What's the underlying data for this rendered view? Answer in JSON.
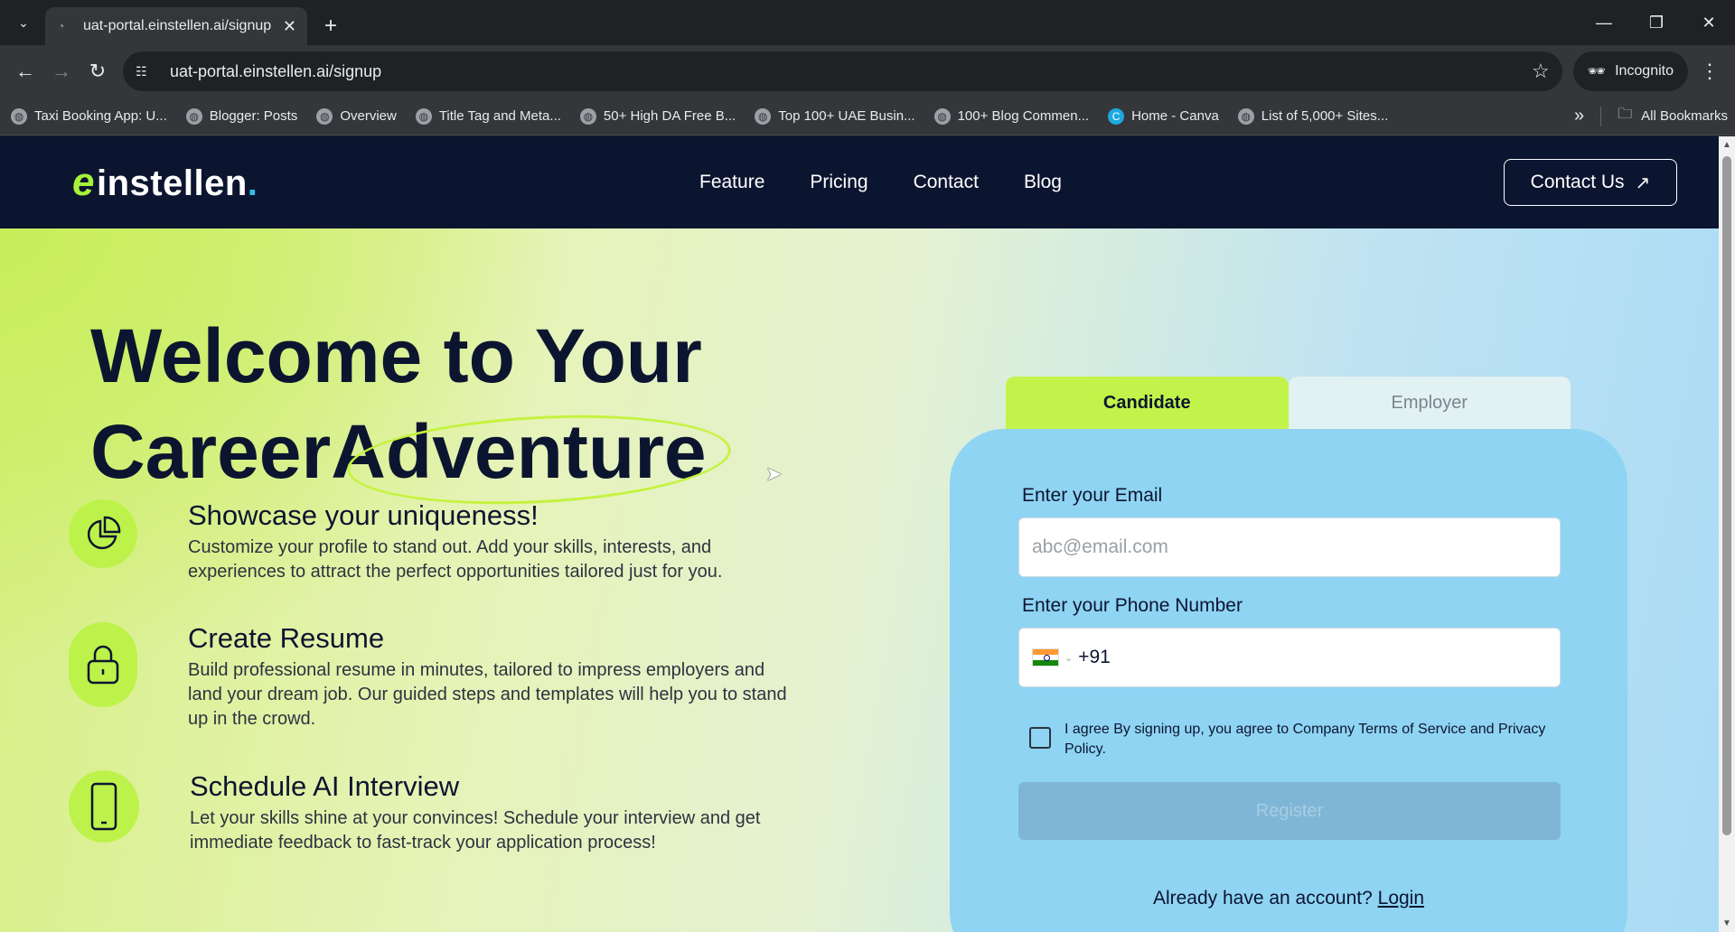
{
  "browser": {
    "tab_title": "uat-portal.einstellen.ai/signup",
    "url": "uat-portal.einstellen.ai/signup",
    "incognito_label": "Incognito",
    "bookmarks": [
      "Taxi Booking App: U...",
      "Blogger: Posts",
      "Overview",
      "Title Tag and Meta...",
      "50+ High DA Free B...",
      "Top 100+ UAE Busin...",
      "100+ Blog Commen...",
      "Home - Canva",
      "List of 5,000+ Sites..."
    ],
    "all_bookmarks": "All Bookmarks"
  },
  "site": {
    "logo_e": "e",
    "logo_text": "instellen",
    "logo_dot": ".",
    "nav": [
      "Feature",
      "Pricing",
      "Contact",
      "Blog"
    ],
    "contact_button": "Contact Us"
  },
  "hero": {
    "title_line1": "Welcome to Your",
    "title_line2_a": "Career",
    "title_line2_b": "Adventure",
    "features": [
      {
        "title": "Showcase your uniqueness!",
        "text": "Customize your profile to stand out. Add your skills, interests, and experiences to attract the perfect opportunities tailored just for you.",
        "icon": "pie-chart-icon"
      },
      {
        "title": "Create Resume",
        "text": "Build professional resume in minutes, tailored to impress employers and land your dream job. Our guided steps and templates will help you to stand up in the crowd.",
        "icon": "lock-icon"
      },
      {
        "title": "Schedule AI Interview",
        "text": "Let your skills shine at your convinces! Schedule your interview and get immediate feedback to fast-track your application process!",
        "icon": "phone-icon"
      }
    ]
  },
  "signup": {
    "tab_candidate": "Candidate",
    "tab_employer": "Employer",
    "email_label": "Enter your Email",
    "email_placeholder": "abc@email.com",
    "phone_label": "Enter your Phone Number",
    "country_code": "+91",
    "agree_text": "I agree By signing up, you agree to Company Terms of Service and Privacy Policy.",
    "register_label": "Register",
    "already_text": "Already have an account?",
    "login_label": "Login"
  },
  "colors": {
    "navy": "#0c1530",
    "lime": "#c2f34a",
    "card_blue": "#8fd4f3"
  }
}
